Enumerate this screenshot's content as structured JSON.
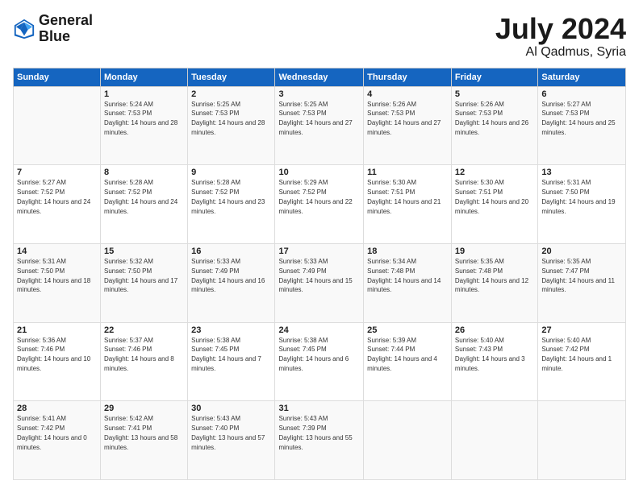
{
  "logo": {
    "line1": "General",
    "line2": "Blue"
  },
  "title": "July 2024",
  "subtitle": "Al Qadmus, Syria",
  "days_of_week": [
    "Sunday",
    "Monday",
    "Tuesday",
    "Wednesday",
    "Thursday",
    "Friday",
    "Saturday"
  ],
  "weeks": [
    [
      {
        "day": "",
        "sunrise": "",
        "sunset": "",
        "daylight": ""
      },
      {
        "day": "1",
        "sunrise": "Sunrise: 5:24 AM",
        "sunset": "Sunset: 7:53 PM",
        "daylight": "Daylight: 14 hours and 28 minutes."
      },
      {
        "day": "2",
        "sunrise": "Sunrise: 5:25 AM",
        "sunset": "Sunset: 7:53 PM",
        "daylight": "Daylight: 14 hours and 28 minutes."
      },
      {
        "day": "3",
        "sunrise": "Sunrise: 5:25 AM",
        "sunset": "Sunset: 7:53 PM",
        "daylight": "Daylight: 14 hours and 27 minutes."
      },
      {
        "day": "4",
        "sunrise": "Sunrise: 5:26 AM",
        "sunset": "Sunset: 7:53 PM",
        "daylight": "Daylight: 14 hours and 27 minutes."
      },
      {
        "day": "5",
        "sunrise": "Sunrise: 5:26 AM",
        "sunset": "Sunset: 7:53 PM",
        "daylight": "Daylight: 14 hours and 26 minutes."
      },
      {
        "day": "6",
        "sunrise": "Sunrise: 5:27 AM",
        "sunset": "Sunset: 7:53 PM",
        "daylight": "Daylight: 14 hours and 25 minutes."
      }
    ],
    [
      {
        "day": "7",
        "sunrise": "Sunrise: 5:27 AM",
        "sunset": "Sunset: 7:52 PM",
        "daylight": "Daylight: 14 hours and 24 minutes."
      },
      {
        "day": "8",
        "sunrise": "Sunrise: 5:28 AM",
        "sunset": "Sunset: 7:52 PM",
        "daylight": "Daylight: 14 hours and 24 minutes."
      },
      {
        "day": "9",
        "sunrise": "Sunrise: 5:28 AM",
        "sunset": "Sunset: 7:52 PM",
        "daylight": "Daylight: 14 hours and 23 minutes."
      },
      {
        "day": "10",
        "sunrise": "Sunrise: 5:29 AM",
        "sunset": "Sunset: 7:52 PM",
        "daylight": "Daylight: 14 hours and 22 minutes."
      },
      {
        "day": "11",
        "sunrise": "Sunrise: 5:30 AM",
        "sunset": "Sunset: 7:51 PM",
        "daylight": "Daylight: 14 hours and 21 minutes."
      },
      {
        "day": "12",
        "sunrise": "Sunrise: 5:30 AM",
        "sunset": "Sunset: 7:51 PM",
        "daylight": "Daylight: 14 hours and 20 minutes."
      },
      {
        "day": "13",
        "sunrise": "Sunrise: 5:31 AM",
        "sunset": "Sunset: 7:50 PM",
        "daylight": "Daylight: 14 hours and 19 minutes."
      }
    ],
    [
      {
        "day": "14",
        "sunrise": "Sunrise: 5:31 AM",
        "sunset": "Sunset: 7:50 PM",
        "daylight": "Daylight: 14 hours and 18 minutes."
      },
      {
        "day": "15",
        "sunrise": "Sunrise: 5:32 AM",
        "sunset": "Sunset: 7:50 PM",
        "daylight": "Daylight: 14 hours and 17 minutes."
      },
      {
        "day": "16",
        "sunrise": "Sunrise: 5:33 AM",
        "sunset": "Sunset: 7:49 PM",
        "daylight": "Daylight: 14 hours and 16 minutes."
      },
      {
        "day": "17",
        "sunrise": "Sunrise: 5:33 AM",
        "sunset": "Sunset: 7:49 PM",
        "daylight": "Daylight: 14 hours and 15 minutes."
      },
      {
        "day": "18",
        "sunrise": "Sunrise: 5:34 AM",
        "sunset": "Sunset: 7:48 PM",
        "daylight": "Daylight: 14 hours and 14 minutes."
      },
      {
        "day": "19",
        "sunrise": "Sunrise: 5:35 AM",
        "sunset": "Sunset: 7:48 PM",
        "daylight": "Daylight: 14 hours and 12 minutes."
      },
      {
        "day": "20",
        "sunrise": "Sunrise: 5:35 AM",
        "sunset": "Sunset: 7:47 PM",
        "daylight": "Daylight: 14 hours and 11 minutes."
      }
    ],
    [
      {
        "day": "21",
        "sunrise": "Sunrise: 5:36 AM",
        "sunset": "Sunset: 7:46 PM",
        "daylight": "Daylight: 14 hours and 10 minutes."
      },
      {
        "day": "22",
        "sunrise": "Sunrise: 5:37 AM",
        "sunset": "Sunset: 7:46 PM",
        "daylight": "Daylight: 14 hours and 8 minutes."
      },
      {
        "day": "23",
        "sunrise": "Sunrise: 5:38 AM",
        "sunset": "Sunset: 7:45 PM",
        "daylight": "Daylight: 14 hours and 7 minutes."
      },
      {
        "day": "24",
        "sunrise": "Sunrise: 5:38 AM",
        "sunset": "Sunset: 7:45 PM",
        "daylight": "Daylight: 14 hours and 6 minutes."
      },
      {
        "day": "25",
        "sunrise": "Sunrise: 5:39 AM",
        "sunset": "Sunset: 7:44 PM",
        "daylight": "Daylight: 14 hours and 4 minutes."
      },
      {
        "day": "26",
        "sunrise": "Sunrise: 5:40 AM",
        "sunset": "Sunset: 7:43 PM",
        "daylight": "Daylight: 14 hours and 3 minutes."
      },
      {
        "day": "27",
        "sunrise": "Sunrise: 5:40 AM",
        "sunset": "Sunset: 7:42 PM",
        "daylight": "Daylight: 14 hours and 1 minute."
      }
    ],
    [
      {
        "day": "28",
        "sunrise": "Sunrise: 5:41 AM",
        "sunset": "Sunset: 7:42 PM",
        "daylight": "Daylight: 14 hours and 0 minutes."
      },
      {
        "day": "29",
        "sunrise": "Sunrise: 5:42 AM",
        "sunset": "Sunset: 7:41 PM",
        "daylight": "Daylight: 13 hours and 58 minutes."
      },
      {
        "day": "30",
        "sunrise": "Sunrise: 5:43 AM",
        "sunset": "Sunset: 7:40 PM",
        "daylight": "Daylight: 13 hours and 57 minutes."
      },
      {
        "day": "31",
        "sunrise": "Sunrise: 5:43 AM",
        "sunset": "Sunset: 7:39 PM",
        "daylight": "Daylight: 13 hours and 55 minutes."
      },
      {
        "day": "",
        "sunrise": "",
        "sunset": "",
        "daylight": ""
      },
      {
        "day": "",
        "sunrise": "",
        "sunset": "",
        "daylight": ""
      },
      {
        "day": "",
        "sunrise": "",
        "sunset": "",
        "daylight": ""
      }
    ]
  ]
}
